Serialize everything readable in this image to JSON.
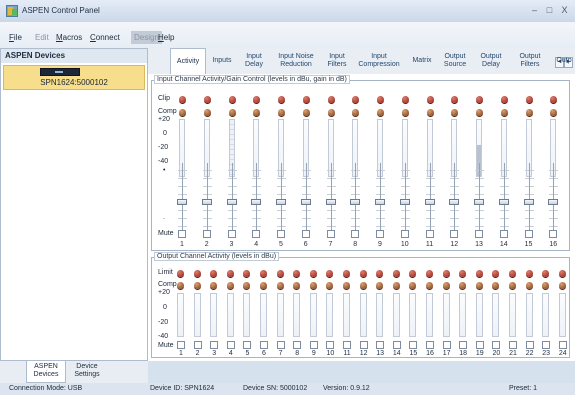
{
  "window": {
    "title": "ASPEN Control Panel",
    "min": "–",
    "max": "□",
    "close": "X"
  },
  "menu": {
    "items": [
      {
        "mnemonic": "F",
        "rest": "ile",
        "disabled": false,
        "selected": false
      },
      {
        "mnemonic": "",
        "rest": "Edit",
        "disabled": true,
        "selected": false
      },
      {
        "mnemonic": "M",
        "rest": "acros",
        "disabled": false,
        "selected": false
      },
      {
        "mnemonic": "C",
        "rest": "onnect",
        "disabled": false,
        "selected": false
      },
      {
        "mnemonic": "",
        "rest": "Design",
        "disabled": true,
        "selected": true
      },
      {
        "mnemonic": "H",
        "rest": "elp",
        "disabled": false,
        "selected": false
      }
    ]
  },
  "left": {
    "header": "ASPEN Devices",
    "device": "SPN1624:5000102",
    "tabs": [
      "ASPEN\nDevices",
      "Device\nSettings"
    ]
  },
  "tabs": [
    "Activity",
    "Inputs",
    "Input\nDelay",
    "Input Noise\nReduction",
    "Input\nFilters",
    "Input\nCompression",
    "Matrix",
    "Output\nSource",
    "Output\nDelay",
    "Output\nFilters",
    "Outp"
  ],
  "tab_nav": {
    "left": "◄",
    "right": "►"
  },
  "input_group": {
    "title": "Input Channel Activity/Gain Control (levels in dBu, gain in dB)",
    "labels": {
      "clip": "Clip",
      "comp": "Comp",
      "p20": "+20",
      "z": "0",
      "m20": "-20",
      "m40": "-40",
      "dot": "•",
      "dot2": ".",
      "mute": "Mute"
    },
    "channels": [
      "1",
      "2",
      "3",
      "4",
      "5",
      "6",
      "7",
      "8",
      "9",
      "10",
      "11",
      "12",
      "13",
      "14",
      "15",
      "16"
    ],
    "levels": [
      0,
      0,
      0,
      0,
      0,
      0,
      0,
      0,
      0,
      0,
      0,
      0,
      0.55,
      0,
      0,
      0
    ],
    "fader": [
      0.58,
      0.58,
      0.58,
      0.58,
      0.58,
      0.58,
      0.58,
      0.58,
      0.58,
      0.58,
      0.58,
      0.58,
      0.58,
      0.58,
      0.58,
      0.58
    ]
  },
  "output_group": {
    "title": "Output Channel Activity (levels in dBu)",
    "labels": {
      "limit": "Limit",
      "comp": "Comp",
      "p20": "+20",
      "z": "0",
      "m20": "-20",
      "m40": "-40",
      "mute": "Mute"
    },
    "channels": [
      "1",
      "2",
      "3",
      "4",
      "5",
      "6",
      "7",
      "8",
      "9",
      "10",
      "11",
      "12",
      "13",
      "14",
      "15",
      "16",
      "17",
      "18",
      "19",
      "20",
      "21",
      "22",
      "23",
      "24"
    ]
  },
  "status": {
    "mode": "Connection Mode: USB",
    "device": "Device ID: SPN1624",
    "sn": "Device SN: 5000102",
    "version": "Version: 0.9.12",
    "preset": "Preset: 1"
  }
}
